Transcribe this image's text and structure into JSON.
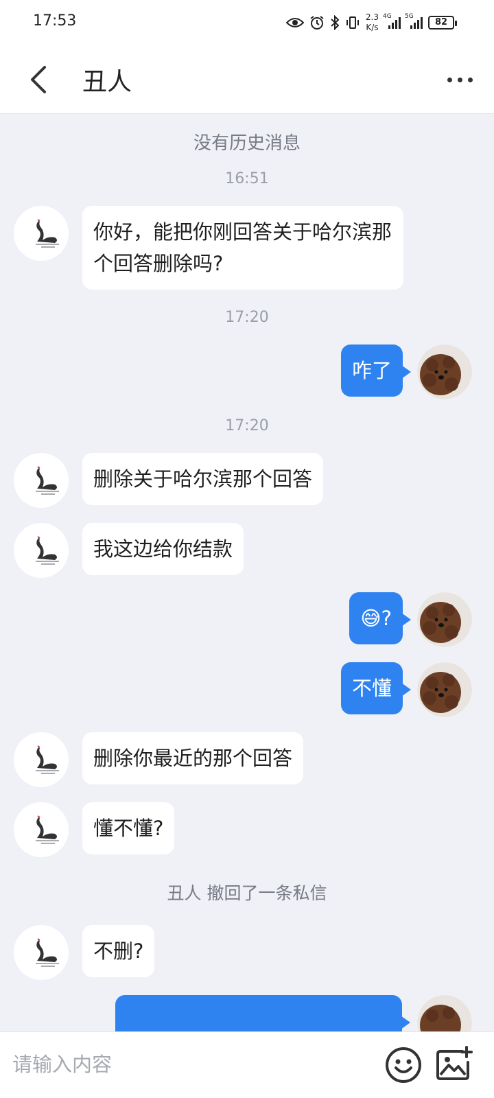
{
  "status_bar": {
    "time": "17:53",
    "net_speed_value": "2.3",
    "net_speed_unit": "K/s",
    "net1": "4G",
    "net2": "5G",
    "battery": "82"
  },
  "header": {
    "title": "丑人"
  },
  "chat": {
    "no_history": "没有历史消息",
    "timestamps": [
      "16:51",
      "17:20",
      "17:20"
    ],
    "recall_notice": "丑人 撤回了一条私信",
    "messages": [
      {
        "side": "in",
        "text": "你好，能把你刚回答关于哈尔滨那个回答删除吗?"
      },
      {
        "side": "out",
        "text": "咋了"
      },
      {
        "side": "in",
        "text": "删除关于哈尔滨那个回答"
      },
      {
        "side": "in",
        "text": "我这边给你结款"
      },
      {
        "side": "out",
        "text": "😅?"
      },
      {
        "side": "out",
        "text": "不懂"
      },
      {
        "side": "in",
        "text": "删除你最近的那个回答"
      },
      {
        "side": "in",
        "text": "懂不懂?"
      },
      {
        "side": "in",
        "text": "不删?"
      }
    ]
  },
  "input": {
    "placeholder": "请输入内容"
  },
  "icons": {
    "back": "chevron-left-icon",
    "more": "more-horizontal-icon",
    "emoji": "smiley-icon",
    "image": "add-image-icon"
  }
}
